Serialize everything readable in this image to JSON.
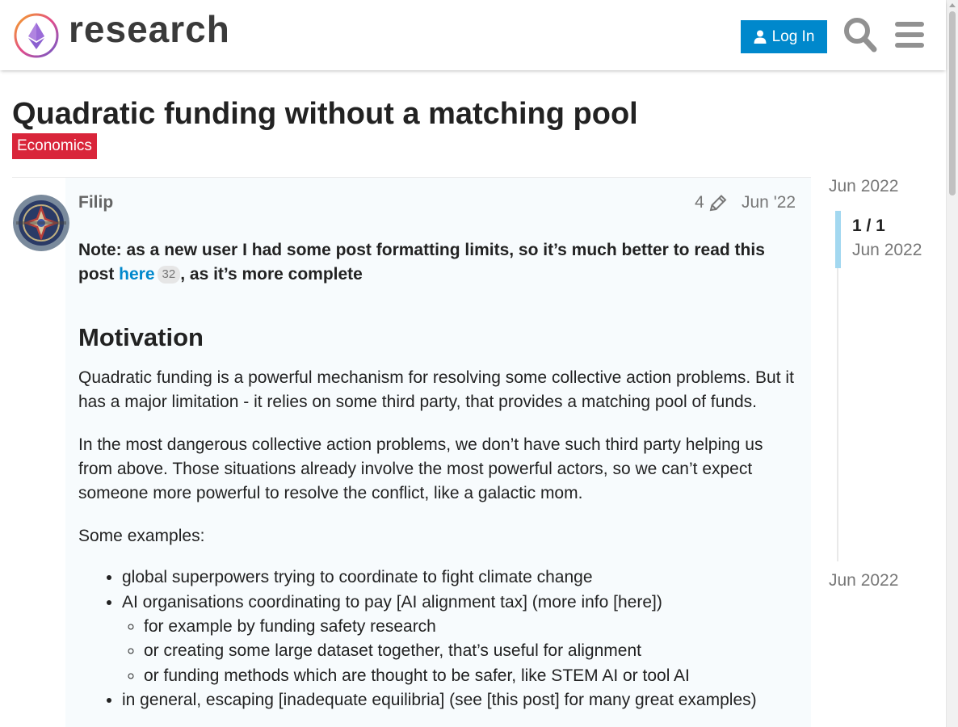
{
  "header": {
    "logo_text": "research",
    "login_label": "Log In"
  },
  "topic": {
    "title": "Quadratic funding without a matching pool",
    "category": "Economics",
    "category_color": "#d9253a"
  },
  "post": {
    "username": "Filip",
    "edit_count": "4",
    "date": "Jun '22",
    "note_prefix": "Note: as a new user I had some post formatting limits, so it’s much better to read this post ",
    "note_link": "here",
    "note_link_clicks": "32",
    "note_suffix": ", as it’s more complete",
    "heading": "Motivation",
    "paragraphs": [
      "Quadratic funding is a powerful mechanism for resolving some collective action problems. But it has a major limitation - it relies on some third party, that provides a matching pool of funds.",
      "In the most dangerous collective action problems, we don’t have such third party helping us from above. Those situations already involve the most powerful actors, so we can’t expect someone more powerful to resolve the conflict, like a galactic mom.",
      "Some examples:"
    ],
    "list": {
      "item1": "global superpowers trying to coordinate to fight climate change",
      "item2": "AI organisations coordinating to pay [AI alignment tax] (more info [here])",
      "sub1": "for example by funding safety research",
      "sub2": "or creating some large dataset together, that’s useful for alignment",
      "sub3": "or funding methods which are thought to be safer, like STEM AI or tool AI",
      "item3": "in general, escaping [inadequate equilibria] (see [this post] for many great examples)"
    }
  },
  "timeline": {
    "top_date": "Jun 2022",
    "position": "1 / 1",
    "current_date": "Jun 2022",
    "bottom_date": "Jun 2022"
  },
  "colors": {
    "accent": "#0088cc",
    "post_bg": "#f7fbfd"
  }
}
